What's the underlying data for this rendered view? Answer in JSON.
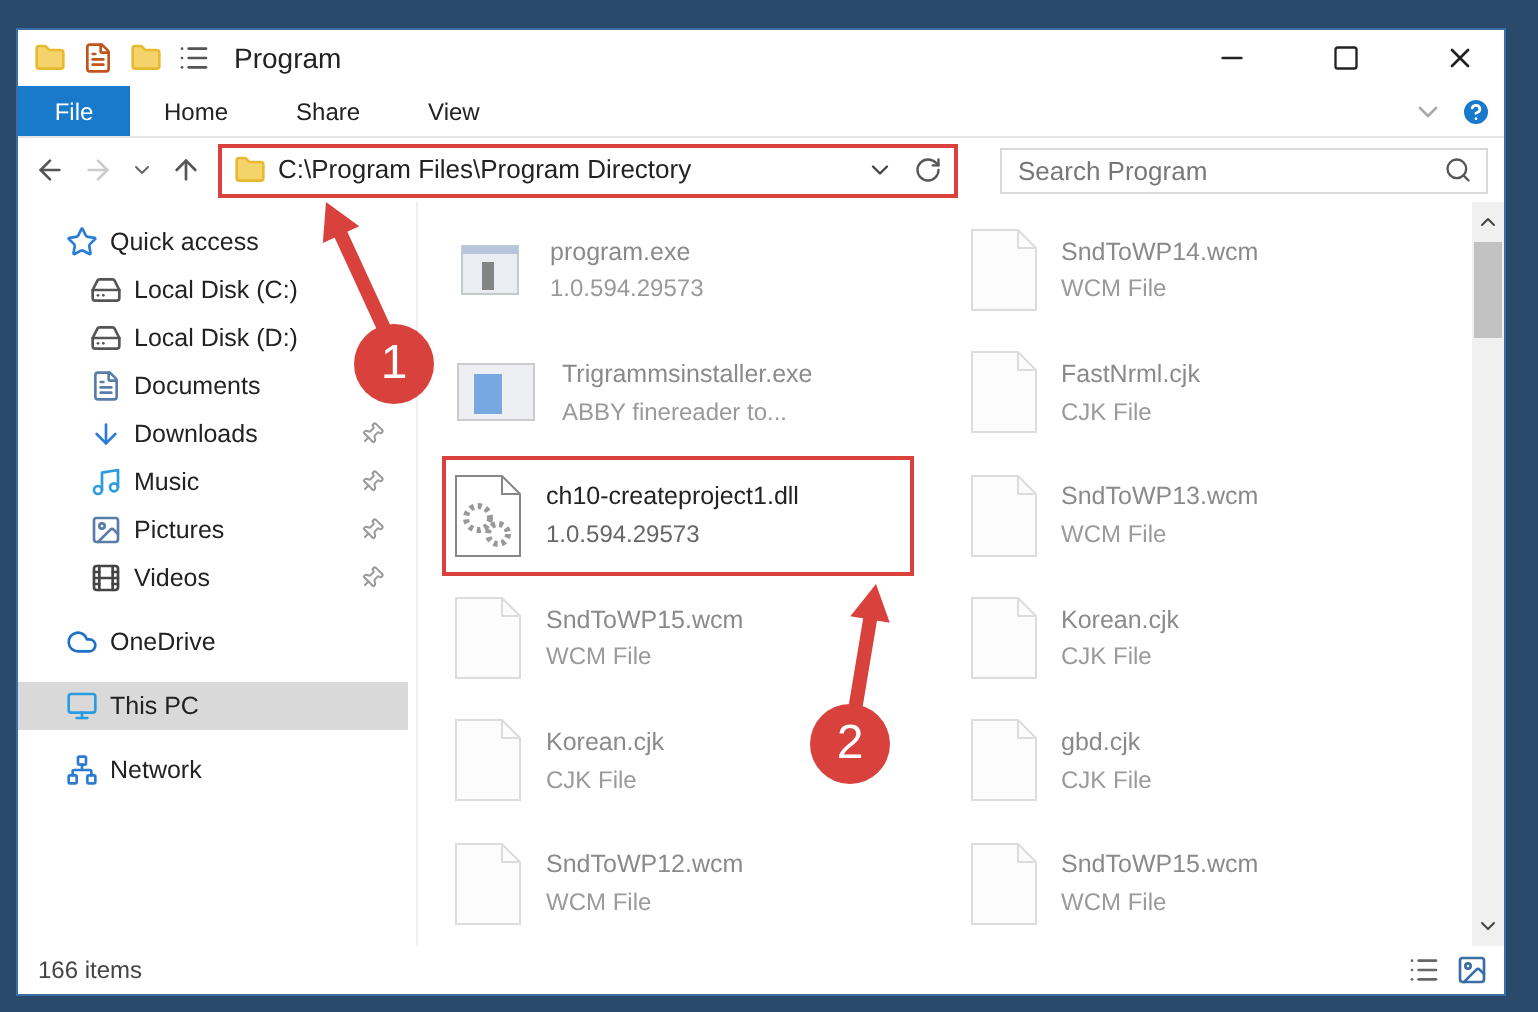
{
  "window": {
    "title": "Program"
  },
  "ribbon_tabs": [
    {
      "label": "File",
      "selected": true
    },
    {
      "label": "Home",
      "selected": false
    },
    {
      "label": "Share",
      "selected": false
    },
    {
      "label": "View",
      "selected": false
    }
  ],
  "address": {
    "path": "C:\\Program Files\\Program Directory",
    "highlighted": true
  },
  "search": {
    "placeholder": "Search Program"
  },
  "sidebar": {
    "items": [
      {
        "label": "Quick access",
        "selected": false,
        "children": [
          {
            "label": "Local Disk (C:)",
            "pinned": false
          },
          {
            "label": "Local Disk (D:)",
            "pinned": false
          },
          {
            "label": "Documents",
            "pinned": false
          },
          {
            "label": "Downloads",
            "pinned": true
          },
          {
            "label": "Music",
            "pinned": true
          },
          {
            "label": "Pictures",
            "pinned": true
          },
          {
            "label": "Videos",
            "pinned": true
          }
        ]
      },
      {
        "label": "OneDrive",
        "selected": false
      },
      {
        "label": "This PC",
        "selected": true
      },
      {
        "label": "Network",
        "selected": false
      }
    ]
  },
  "files": [
    {
      "name": "program.exe",
      "detail": "1.0.594.29573",
      "kind": "exe",
      "highlighted": false
    },
    {
      "name": "Trigrammsinstaller.exe",
      "detail": "ABBY finereader to...",
      "kind": "installer",
      "highlighted": false
    },
    {
      "name": "ch10-createproject1.dll",
      "detail": "1.0.594.29573",
      "kind": "dll",
      "highlighted": true
    },
    {
      "name": "SndToWP15.wcm",
      "detail": "WCM File",
      "kind": "doc",
      "highlighted": false
    },
    {
      "name": "Korean.cjk",
      "detail": "CJK File",
      "kind": "doc",
      "highlighted": false
    },
    {
      "name": "SndToWP12.wcm",
      "detail": "WCM File",
      "kind": "doc",
      "highlighted": false
    },
    {
      "name": "SndToWP14.wcm",
      "detail": "WCM File",
      "kind": "doc",
      "highlighted": false
    },
    {
      "name": "FastNrml.cjk",
      "detail": "CJK File",
      "kind": "doc",
      "highlighted": false
    },
    {
      "name": "SndToWP13.wcm",
      "detail": "WCM File",
      "kind": "doc",
      "highlighted": false
    },
    {
      "name": "Korean.cjk",
      "detail": "CJK File",
      "kind": "doc",
      "highlighted": false
    },
    {
      "name": "gbd.cjk",
      "detail": "CJK File",
      "kind": "doc",
      "highlighted": false
    },
    {
      "name": "SndToWP15.wcm",
      "detail": "WCM File",
      "kind": "doc",
      "highlighted": false
    }
  ],
  "status_bar": {
    "count": "166 items"
  },
  "callouts": [
    {
      "number": "1"
    },
    {
      "number": "2"
    }
  ]
}
